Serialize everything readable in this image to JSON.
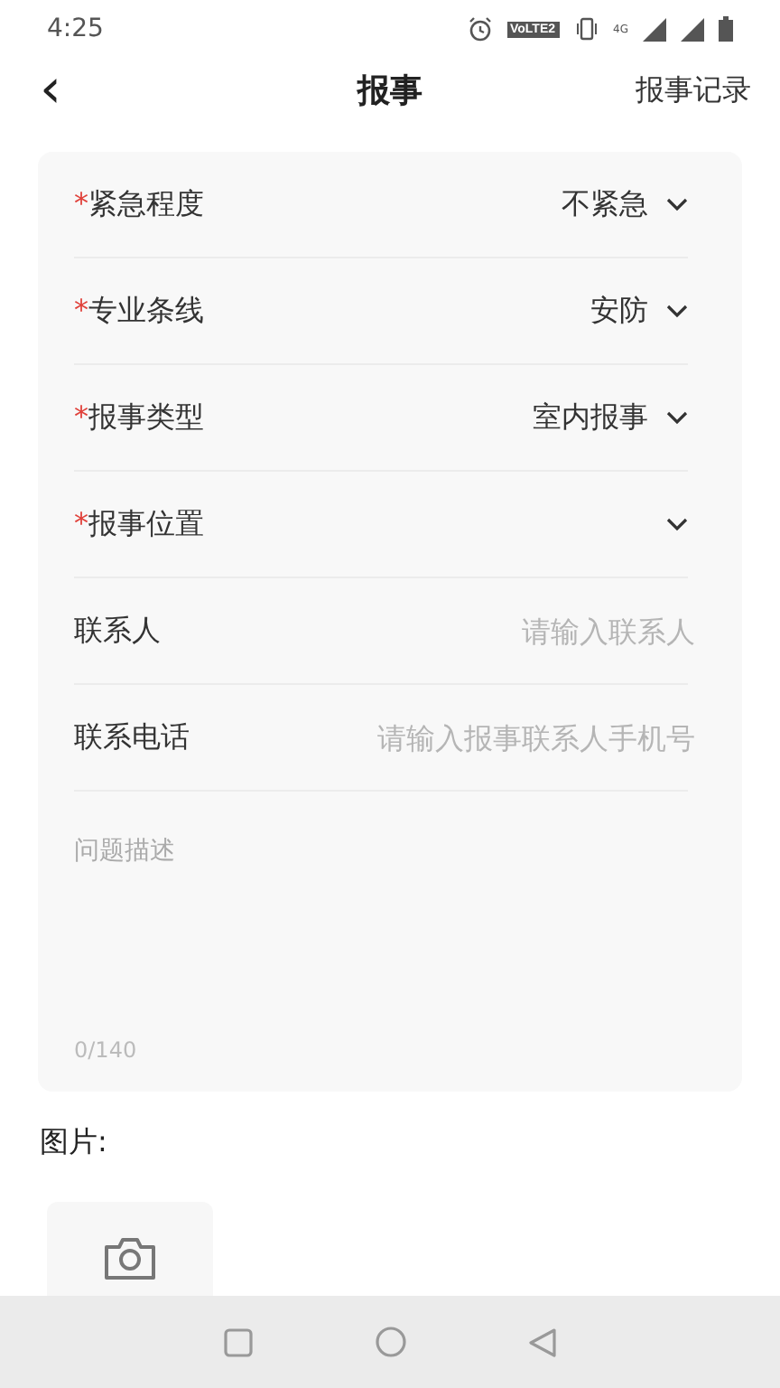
{
  "status_bar": {
    "time": "4:25",
    "volte": "VoLTE2",
    "network": "4G"
  },
  "header": {
    "back": "‹",
    "title": "报事",
    "action": "报事记录"
  },
  "fields": [
    {
      "kind": "select",
      "mark": "*",
      "label": "紧急程度",
      "value": "不紧急"
    },
    {
      "kind": "select",
      "mark": "*",
      "label": "专业条线",
      "value": "安防"
    },
    {
      "kind": "select",
      "mark": "*",
      "label": "报事类型",
      "value": "室内报事"
    },
    {
      "kind": "select",
      "mark": "*",
      "label": "报事位置"
    },
    {
      "kind": "input",
      "label": "联系人",
      "placeholder": "请输入联系人"
    },
    {
      "kind": "input",
      "label": "联系电话",
      "placeholder": "请输入报事联系人手机号"
    }
  ],
  "description": {
    "placeholder": "问题描述",
    "counter": "0/140"
  },
  "images": {
    "label": "图片:"
  }
}
